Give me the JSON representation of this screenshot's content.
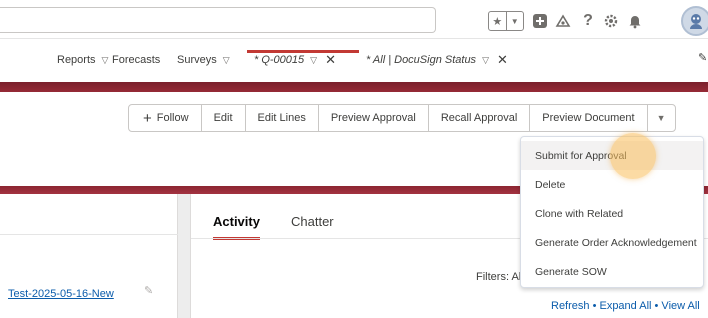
{
  "header": {
    "search": {
      "placeholder": ""
    },
    "icons": [
      "star-icon",
      "chevron-down-icon",
      "grid-plus-icon",
      "trailhead-icon",
      "help-icon",
      "setup-gear-icon",
      "notification-bell-icon",
      "avatar"
    ]
  },
  "nav": {
    "items": [
      {
        "label": "Reports",
        "has_menu": true
      },
      {
        "label": "Forecasts",
        "has_menu": false
      },
      {
        "label": "Surveys",
        "has_menu": true
      }
    ],
    "tabs": [
      {
        "label": "* Q-00015",
        "active": true
      },
      {
        "label": "* All | DocuSign Status",
        "active": false
      }
    ]
  },
  "actions": {
    "follow": "Follow",
    "buttons": [
      "Edit",
      "Edit Lines",
      "Preview Approval",
      "Recall Approval",
      "Preview Document"
    ]
  },
  "menu": {
    "items": [
      "Submit for Approval",
      "Delete",
      "Clone with Related",
      "Generate Order Acknowledgement",
      "Generate SOW"
    ],
    "hovered_index": 0
  },
  "record": {
    "link_text": "Test-2025-05-16-New"
  },
  "activity": {
    "tabs": [
      "Activity",
      "Chatter"
    ],
    "active_tab": "Activity",
    "filters_text": "Filters: All",
    "links_text": "Refresh • Expand All • View All"
  },
  "colors": {
    "brand_band": "#8c2531",
    "active_tab_accent": "#c23934",
    "link": "#0b5cab",
    "cursor_highlight": "#f5b95a"
  }
}
